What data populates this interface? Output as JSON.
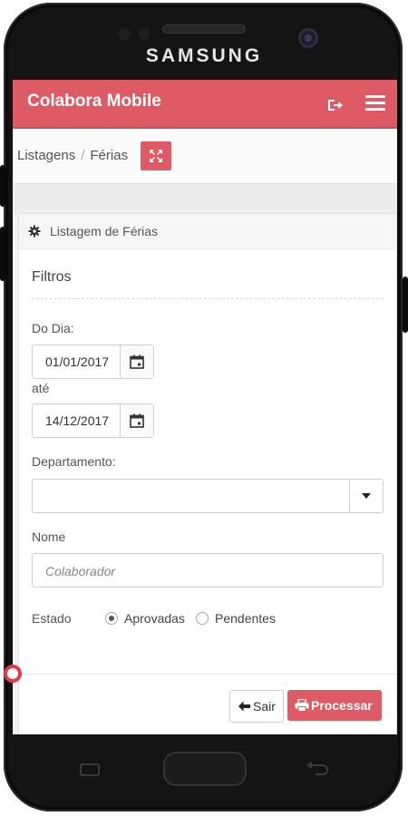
{
  "device": {
    "brand": "SAMSUNG"
  },
  "app": {
    "title": "Colabora Mobile",
    "accent_color": "#de5a64"
  },
  "header": {
    "icons": [
      "logout-icon",
      "hamburger-menu-icon"
    ]
  },
  "breadcrumb": {
    "items": [
      "Listagens",
      "Férias"
    ],
    "separator": "/",
    "action_icon": "expand-icon"
  },
  "panel": {
    "title": "Listagem de Férias",
    "icon": "gear-icon",
    "filters_title": "Filtros",
    "from": {
      "label": "Do Dia:",
      "value": "01/01/2017"
    },
    "to": {
      "label": "até",
      "value": "14/12/2017"
    },
    "department": {
      "label": "Departamento:",
      "value": ""
    },
    "name": {
      "label": "Nome",
      "placeholder": "Colaborador"
    },
    "state": {
      "label": "Estado",
      "options": [
        "Aprovadas",
        "Pendentes"
      ],
      "selected": "Aprovadas"
    }
  },
  "actions": {
    "exit_label": "Sair",
    "process_label": "Processar"
  }
}
